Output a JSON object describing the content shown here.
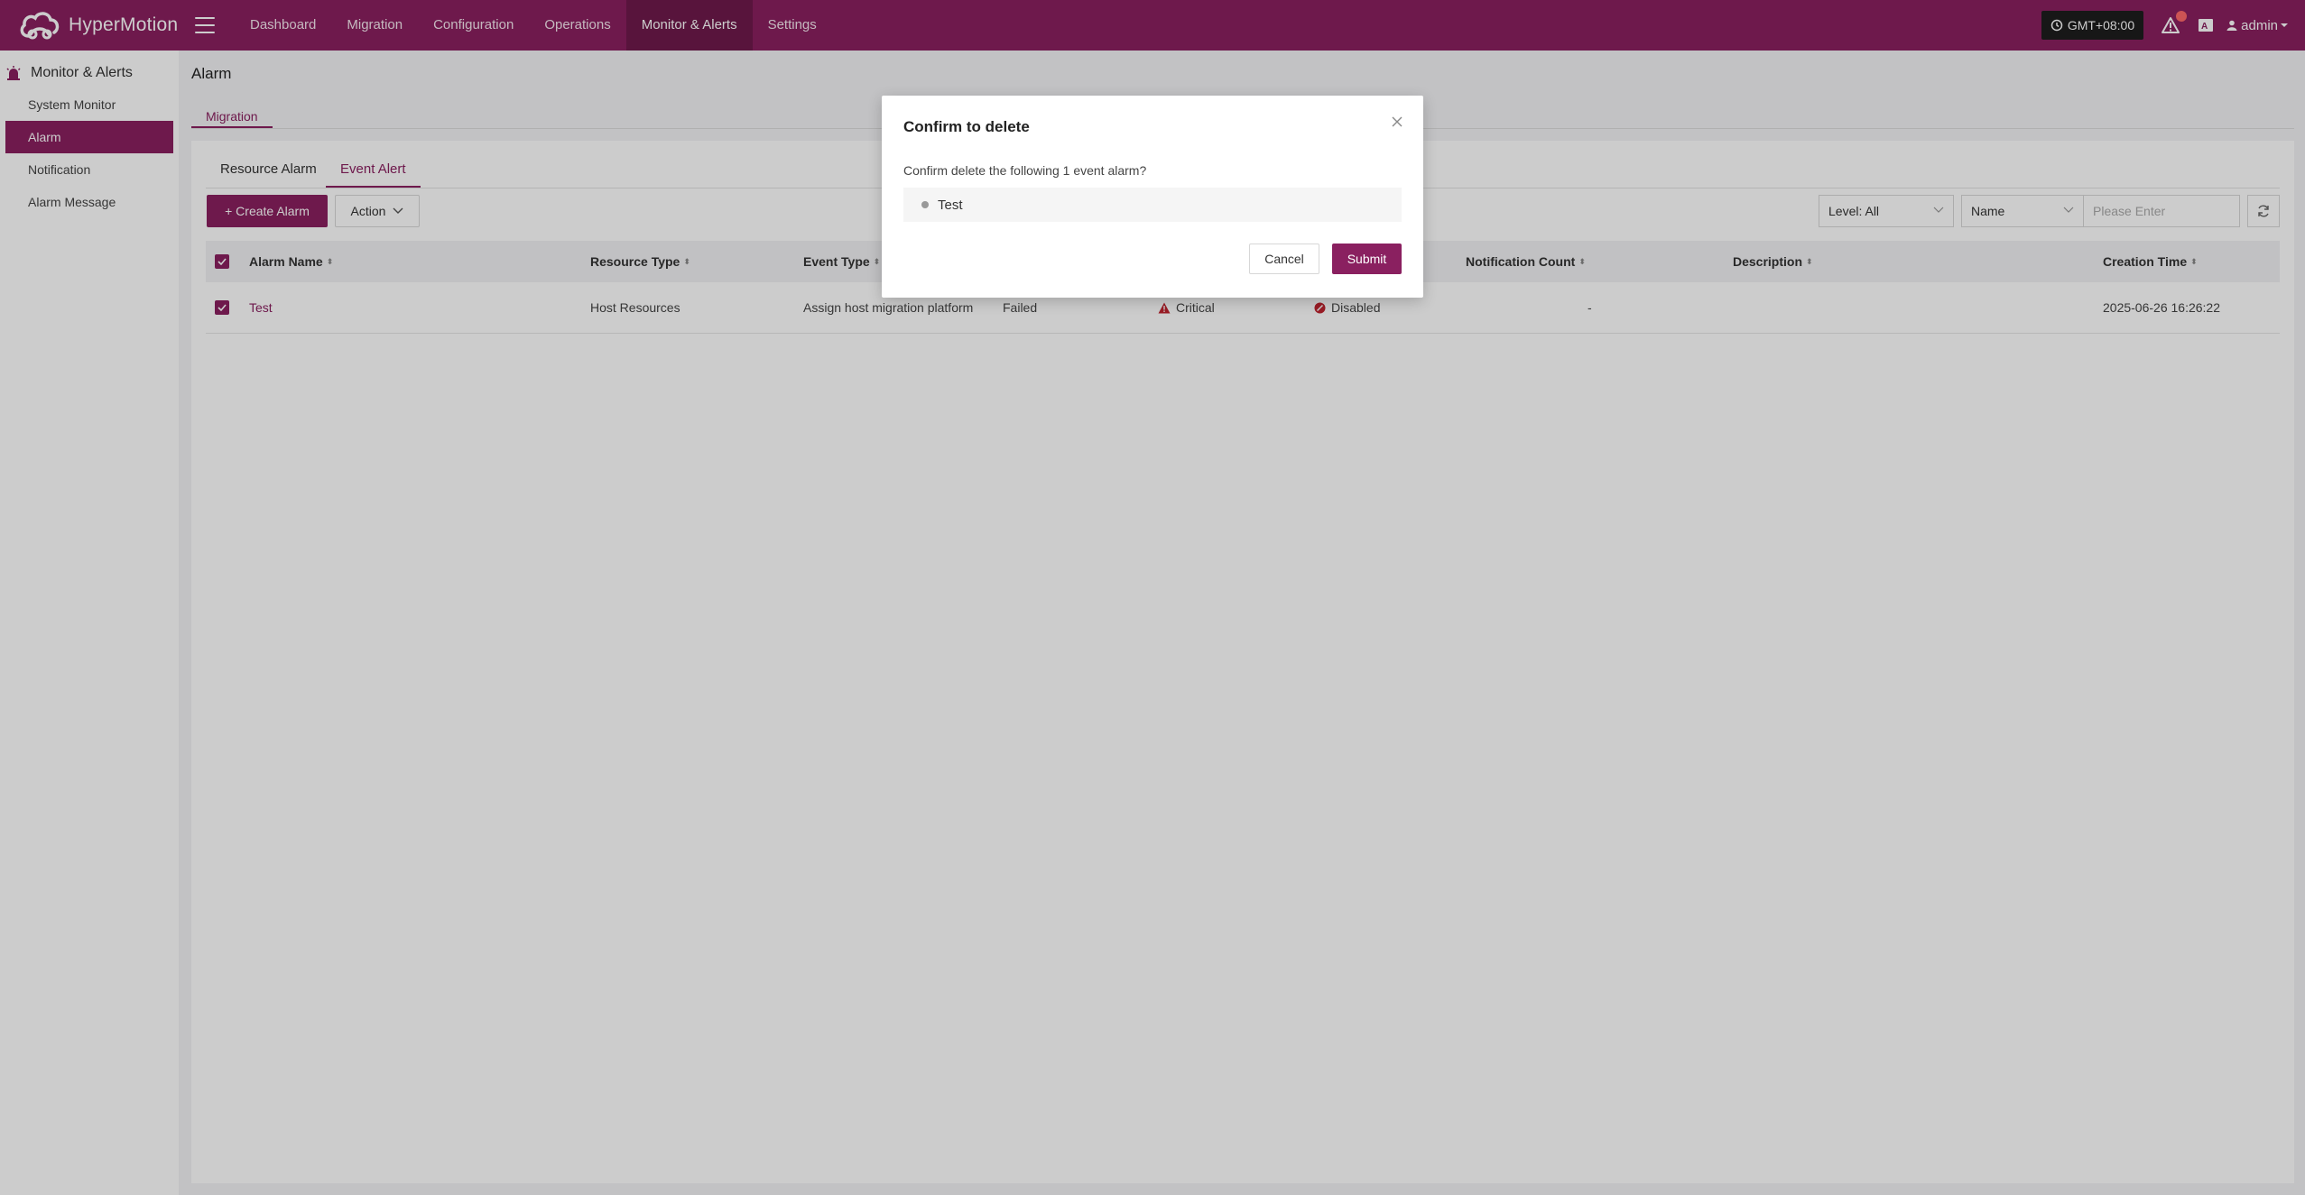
{
  "app": {
    "name": "HyperMotion"
  },
  "nav": {
    "items": [
      {
        "label": "Dashboard"
      },
      {
        "label": "Migration"
      },
      {
        "label": "Configuration"
      },
      {
        "label": "Operations"
      },
      {
        "label": "Monitor & Alerts",
        "active": true
      },
      {
        "label": "Settings"
      }
    ]
  },
  "topright": {
    "timezone": "GMT+08:00",
    "user": "admin"
  },
  "sidebar": {
    "section": "Monitor & Alerts",
    "items": [
      {
        "label": "System Monitor"
      },
      {
        "label": "Alarm",
        "active": true
      },
      {
        "label": "Notification"
      },
      {
        "label": "Alarm Message"
      }
    ]
  },
  "page": {
    "title": "Alarm",
    "subtab": "Migration"
  },
  "tabs": [
    {
      "label": "Resource Alarm"
    },
    {
      "label": "Event Alert",
      "active": true
    }
  ],
  "toolbar": {
    "create_label": "+ Create Alarm",
    "action_label": "Action",
    "level_select": "Level: All",
    "field_select": "Name",
    "search_placeholder": "Please Enter"
  },
  "table": {
    "columns": [
      "Alarm Name",
      "Resource Type",
      "Event Type",
      "Notification Count",
      "Description",
      "Creation Time"
    ],
    "rows": [
      {
        "name": "Test",
        "resource_type": "Host Resources",
        "event_type": "Assign host migration platform",
        "result": "Failed",
        "level": "Critical",
        "status": "Disabled",
        "notification_count": "-",
        "description": "",
        "creation_time": "2025-06-26 16:26:22"
      }
    ]
  },
  "modal": {
    "title": "Confirm to delete",
    "message": "Confirm delete the following 1 event alarm?",
    "items": [
      "Test"
    ],
    "cancel_label": "Cancel",
    "submit_label": "Submit"
  },
  "colors": {
    "brand": "#8a2060",
    "brand_dark": "#6e1a4c",
    "critical": "#c0242f"
  }
}
